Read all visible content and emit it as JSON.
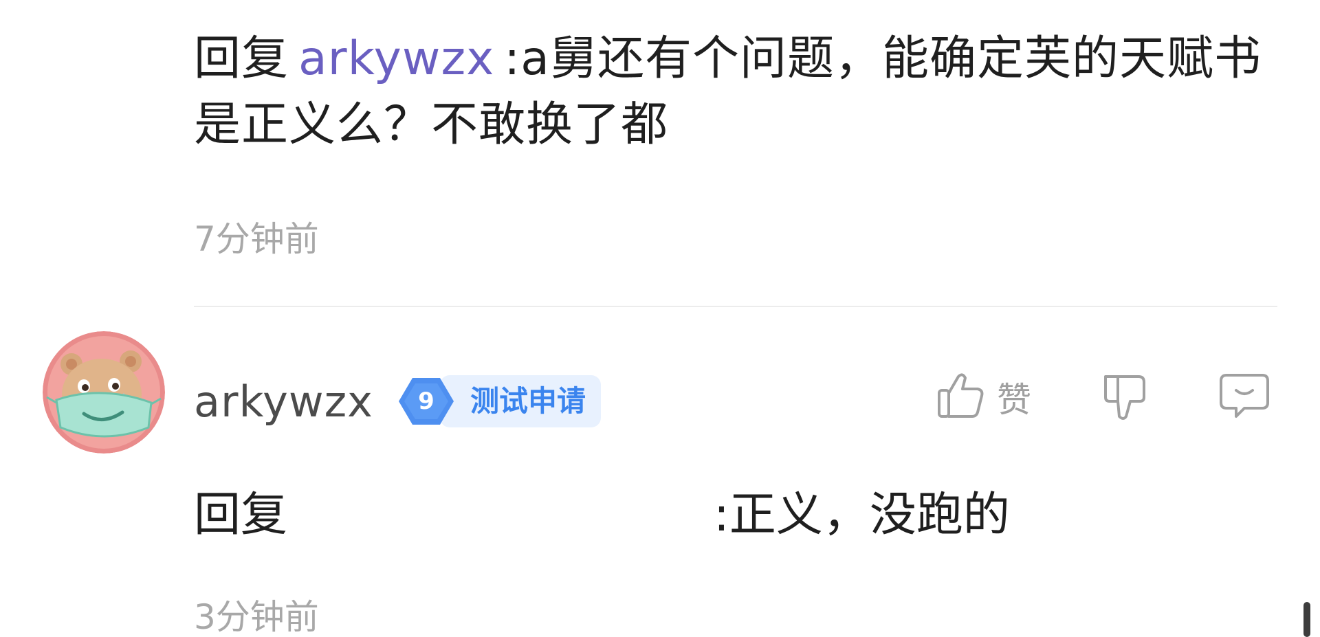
{
  "comment_prev": {
    "reply_prefix": "回复",
    "mention": "arkywzx",
    "text": ":a舅还有个问题，能确定芙的天赋书是正义么？不敢换了都",
    "time": "7分钟前"
  },
  "comment": {
    "author": "arkywzx",
    "badge": {
      "level": "9",
      "label": "测试申请"
    },
    "like_label": "赞",
    "reply_prefix": "回复",
    "text": ":正义，没跑的",
    "time": "3分钟前"
  },
  "icons": {
    "avatar": "bear-with-mask-avatar",
    "like": "thumbs-up-icon",
    "dislike": "thumbs-down-icon",
    "reply": "comment-bubble-icon"
  },
  "colors": {
    "mention": "#6a5fc1",
    "badge_blue": "#3a84ee",
    "badge_bg": "#e8f1fe",
    "muted": "#a8a8a8"
  }
}
